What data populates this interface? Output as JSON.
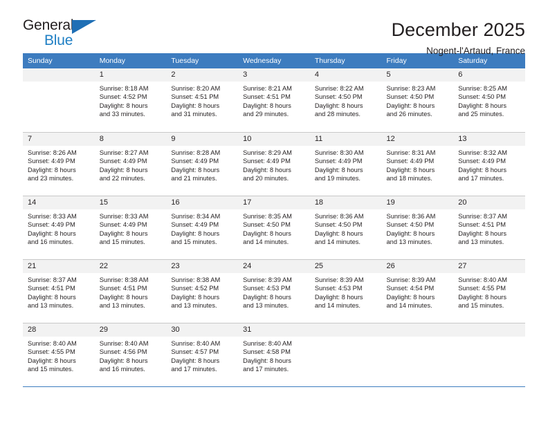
{
  "brand": {
    "name_part1": "General",
    "name_part2": "Blue",
    "accent_color": "#1f7fc4",
    "triangle_color": "#1f6fb5"
  },
  "header": {
    "title": "December 2025",
    "subtitle": "Nogent-l'Artaud, France"
  },
  "calendar": {
    "header_bg": "#3d7cbf",
    "weekdays": [
      "Sunday",
      "Monday",
      "Tuesday",
      "Wednesday",
      "Thursday",
      "Friday",
      "Saturday"
    ],
    "weeks": [
      [
        {
          "day": "",
          "sunrise": "",
          "sunset": "",
          "daylight_line1": "",
          "daylight_line2": ""
        },
        {
          "day": "1",
          "sunrise": "Sunrise: 8:18 AM",
          "sunset": "Sunset: 4:52 PM",
          "daylight_line1": "Daylight: 8 hours",
          "daylight_line2": "and 33 minutes."
        },
        {
          "day": "2",
          "sunrise": "Sunrise: 8:20 AM",
          "sunset": "Sunset: 4:51 PM",
          "daylight_line1": "Daylight: 8 hours",
          "daylight_line2": "and 31 minutes."
        },
        {
          "day": "3",
          "sunrise": "Sunrise: 8:21 AM",
          "sunset": "Sunset: 4:51 PM",
          "daylight_line1": "Daylight: 8 hours",
          "daylight_line2": "and 29 minutes."
        },
        {
          "day": "4",
          "sunrise": "Sunrise: 8:22 AM",
          "sunset": "Sunset: 4:50 PM",
          "daylight_line1": "Daylight: 8 hours",
          "daylight_line2": "and 28 minutes."
        },
        {
          "day": "5",
          "sunrise": "Sunrise: 8:23 AM",
          "sunset": "Sunset: 4:50 PM",
          "daylight_line1": "Daylight: 8 hours",
          "daylight_line2": "and 26 minutes."
        },
        {
          "day": "6",
          "sunrise": "Sunrise: 8:25 AM",
          "sunset": "Sunset: 4:50 PM",
          "daylight_line1": "Daylight: 8 hours",
          "daylight_line2": "and 25 minutes."
        }
      ],
      [
        {
          "day": "7",
          "sunrise": "Sunrise: 8:26 AM",
          "sunset": "Sunset: 4:49 PM",
          "daylight_line1": "Daylight: 8 hours",
          "daylight_line2": "and 23 minutes."
        },
        {
          "day": "8",
          "sunrise": "Sunrise: 8:27 AM",
          "sunset": "Sunset: 4:49 PM",
          "daylight_line1": "Daylight: 8 hours",
          "daylight_line2": "and 22 minutes."
        },
        {
          "day": "9",
          "sunrise": "Sunrise: 8:28 AM",
          "sunset": "Sunset: 4:49 PM",
          "daylight_line1": "Daylight: 8 hours",
          "daylight_line2": "and 21 minutes."
        },
        {
          "day": "10",
          "sunrise": "Sunrise: 8:29 AM",
          "sunset": "Sunset: 4:49 PM",
          "daylight_line1": "Daylight: 8 hours",
          "daylight_line2": "and 20 minutes."
        },
        {
          "day": "11",
          "sunrise": "Sunrise: 8:30 AM",
          "sunset": "Sunset: 4:49 PM",
          "daylight_line1": "Daylight: 8 hours",
          "daylight_line2": "and 19 minutes."
        },
        {
          "day": "12",
          "sunrise": "Sunrise: 8:31 AM",
          "sunset": "Sunset: 4:49 PM",
          "daylight_line1": "Daylight: 8 hours",
          "daylight_line2": "and 18 minutes."
        },
        {
          "day": "13",
          "sunrise": "Sunrise: 8:32 AM",
          "sunset": "Sunset: 4:49 PM",
          "daylight_line1": "Daylight: 8 hours",
          "daylight_line2": "and 17 minutes."
        }
      ],
      [
        {
          "day": "14",
          "sunrise": "Sunrise: 8:33 AM",
          "sunset": "Sunset: 4:49 PM",
          "daylight_line1": "Daylight: 8 hours",
          "daylight_line2": "and 16 minutes."
        },
        {
          "day": "15",
          "sunrise": "Sunrise: 8:33 AM",
          "sunset": "Sunset: 4:49 PM",
          "daylight_line1": "Daylight: 8 hours",
          "daylight_line2": "and 15 minutes."
        },
        {
          "day": "16",
          "sunrise": "Sunrise: 8:34 AM",
          "sunset": "Sunset: 4:49 PM",
          "daylight_line1": "Daylight: 8 hours",
          "daylight_line2": "and 15 minutes."
        },
        {
          "day": "17",
          "sunrise": "Sunrise: 8:35 AM",
          "sunset": "Sunset: 4:50 PM",
          "daylight_line1": "Daylight: 8 hours",
          "daylight_line2": "and 14 minutes."
        },
        {
          "day": "18",
          "sunrise": "Sunrise: 8:36 AM",
          "sunset": "Sunset: 4:50 PM",
          "daylight_line1": "Daylight: 8 hours",
          "daylight_line2": "and 14 minutes."
        },
        {
          "day": "19",
          "sunrise": "Sunrise: 8:36 AM",
          "sunset": "Sunset: 4:50 PM",
          "daylight_line1": "Daylight: 8 hours",
          "daylight_line2": "and 13 minutes."
        },
        {
          "day": "20",
          "sunrise": "Sunrise: 8:37 AM",
          "sunset": "Sunset: 4:51 PM",
          "daylight_line1": "Daylight: 8 hours",
          "daylight_line2": "and 13 minutes."
        }
      ],
      [
        {
          "day": "21",
          "sunrise": "Sunrise: 8:37 AM",
          "sunset": "Sunset: 4:51 PM",
          "daylight_line1": "Daylight: 8 hours",
          "daylight_line2": "and 13 minutes."
        },
        {
          "day": "22",
          "sunrise": "Sunrise: 8:38 AM",
          "sunset": "Sunset: 4:51 PM",
          "daylight_line1": "Daylight: 8 hours",
          "daylight_line2": "and 13 minutes."
        },
        {
          "day": "23",
          "sunrise": "Sunrise: 8:38 AM",
          "sunset": "Sunset: 4:52 PM",
          "daylight_line1": "Daylight: 8 hours",
          "daylight_line2": "and 13 minutes."
        },
        {
          "day": "24",
          "sunrise": "Sunrise: 8:39 AM",
          "sunset": "Sunset: 4:53 PM",
          "daylight_line1": "Daylight: 8 hours",
          "daylight_line2": "and 13 minutes."
        },
        {
          "day": "25",
          "sunrise": "Sunrise: 8:39 AM",
          "sunset": "Sunset: 4:53 PM",
          "daylight_line1": "Daylight: 8 hours",
          "daylight_line2": "and 14 minutes."
        },
        {
          "day": "26",
          "sunrise": "Sunrise: 8:39 AM",
          "sunset": "Sunset: 4:54 PM",
          "daylight_line1": "Daylight: 8 hours",
          "daylight_line2": "and 14 minutes."
        },
        {
          "day": "27",
          "sunrise": "Sunrise: 8:40 AM",
          "sunset": "Sunset: 4:55 PM",
          "daylight_line1": "Daylight: 8 hours",
          "daylight_line2": "and 15 minutes."
        }
      ],
      [
        {
          "day": "28",
          "sunrise": "Sunrise: 8:40 AM",
          "sunset": "Sunset: 4:55 PM",
          "daylight_line1": "Daylight: 8 hours",
          "daylight_line2": "and 15 minutes."
        },
        {
          "day": "29",
          "sunrise": "Sunrise: 8:40 AM",
          "sunset": "Sunset: 4:56 PM",
          "daylight_line1": "Daylight: 8 hours",
          "daylight_line2": "and 16 minutes."
        },
        {
          "day": "30",
          "sunrise": "Sunrise: 8:40 AM",
          "sunset": "Sunset: 4:57 PM",
          "daylight_line1": "Daylight: 8 hours",
          "daylight_line2": "and 17 minutes."
        },
        {
          "day": "31",
          "sunrise": "Sunrise: 8:40 AM",
          "sunset": "Sunset: 4:58 PM",
          "daylight_line1": "Daylight: 8 hours",
          "daylight_line2": "and 17 minutes."
        },
        {
          "day": "",
          "sunrise": "",
          "sunset": "",
          "daylight_line1": "",
          "daylight_line2": ""
        },
        {
          "day": "",
          "sunrise": "",
          "sunset": "",
          "daylight_line1": "",
          "daylight_line2": ""
        },
        {
          "day": "",
          "sunrise": "",
          "sunset": "",
          "daylight_line1": "",
          "daylight_line2": ""
        }
      ]
    ]
  }
}
